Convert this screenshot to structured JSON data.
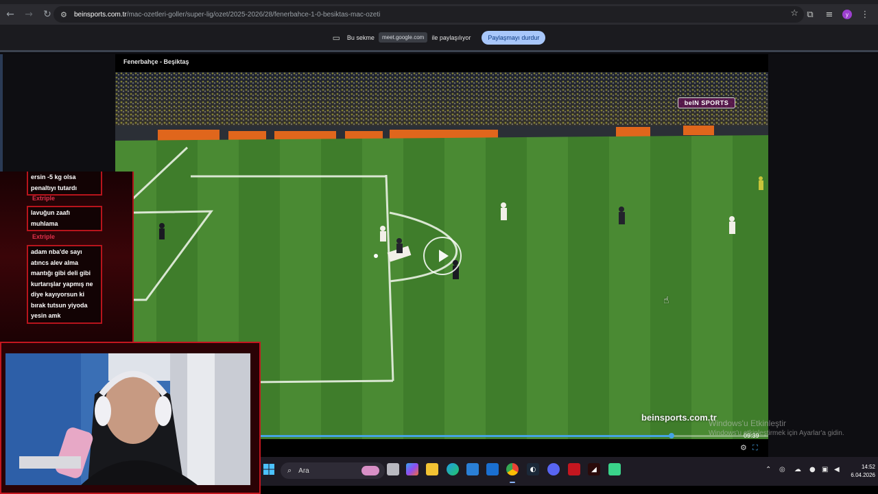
{
  "browser": {
    "url_host": "beinsports.com.tr",
    "url_path": "/mac-ozetleri-goller/super-lig/ozet/2025-2026/28/fenerbahce-1-0-besiktas-mac-ozeti",
    "back_icon": "arrow-left-icon",
    "forward_icon": "arrow-right-icon",
    "reload_icon": "reload-icon",
    "profile_initial": "y"
  },
  "share_bar": {
    "prefix": "Bu sekme",
    "target": "meet.google.com",
    "suffix": "ile paylaşılıyor",
    "stop_label": "Paylaşmayı durdur"
  },
  "video": {
    "title": "Fenerbahçe - Beşiktaş",
    "channel_logo": "beIN SPORTS",
    "watermark": "beinsports.com.tr",
    "time": "09:39",
    "progress": 0.81
  },
  "windows_activation": {
    "title": "Windows'u Etkinleştir",
    "subtitle": "Windows'u etkinleştirmek için Ayarlar'a gidin."
  },
  "chat": {
    "messages": [
      {
        "text": "ersin -5 kg olsa penaltıyı tutardı"
      },
      {
        "user": "Extriple",
        "text": "lavuğun zaafı muhlama"
      },
      {
        "user": "Extriple",
        "text": "adam nba'de sayı atıncs alev alma mantığı gibi deli gibi kurtarışlar yapmış ne diye kayıyorsun ki bırak tutsun yiyoda yesin amk"
      }
    ]
  },
  "taskbar": {
    "search_placeholder": "Ara",
    "time": "14:52",
    "date": "6.04.2026"
  },
  "colors": {
    "accent_red": "#c4161f",
    "share_stop": "#a8c7fa",
    "progress": "#45a3e5"
  }
}
